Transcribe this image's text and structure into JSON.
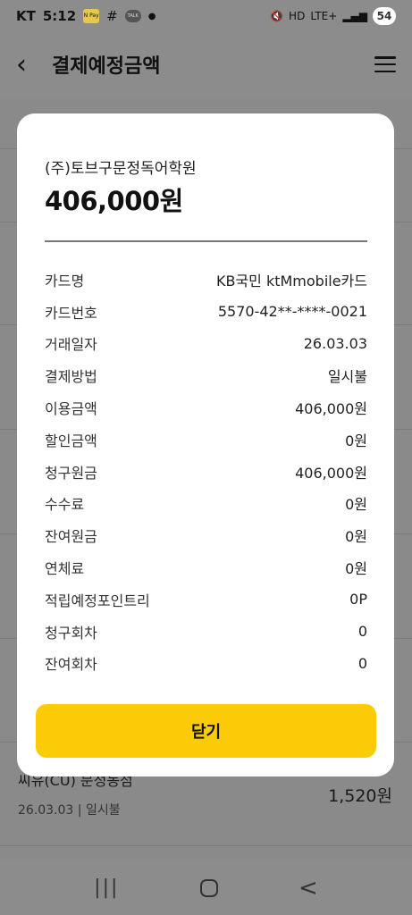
{
  "status_bar": {
    "carrier": "KT",
    "time": "5:12",
    "pay_icon_text": "N Pay",
    "talk_icon_text": "TALK",
    "network": "LTE+",
    "battery": "54"
  },
  "header": {
    "title": "결제예정금액"
  },
  "modal": {
    "merchant": "(주)토브구문정독어학원",
    "total_amount": "406,000원",
    "details": [
      {
        "label": "카드명",
        "value": "KB국민 ktMmobile카드"
      },
      {
        "label": "카드번호",
        "value": "5570-42**-****-0021"
      },
      {
        "label": "거래일자",
        "value": "26.03.03"
      },
      {
        "label": "결제방법",
        "value": "일시불"
      },
      {
        "label": "이용금액",
        "value": "406,000원"
      },
      {
        "label": "할인금액",
        "value": "0원"
      },
      {
        "label": "청구원금",
        "value": "406,000원"
      },
      {
        "label": "수수료",
        "value": "0원"
      },
      {
        "label": "잔여원금",
        "value": "0원"
      },
      {
        "label": "연체료",
        "value": "0원"
      },
      {
        "label": "적립예정포인트리",
        "value": "0P"
      },
      {
        "label": "청구회차",
        "value": "0"
      },
      {
        "label": "잔여회차",
        "value": "0"
      }
    ],
    "close_label": "닫기"
  },
  "background_item": {
    "merchant": "씨유(CU) 문정동점",
    "amount": "1,520원",
    "date_method": "26.03.03 | 일시불"
  },
  "nav": {
    "recent": "|||",
    "back": "<"
  }
}
